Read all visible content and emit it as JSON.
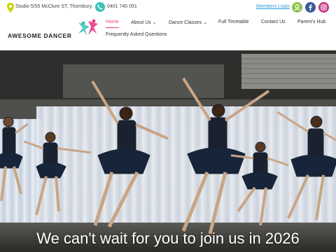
{
  "topbar": {
    "address": "Studio 5/55 McClure ST, Thornbury.",
    "phone": "0401 740 051",
    "members_login": "Members Login",
    "icons": [
      "location-pin-icon",
      "phone-icon",
      "user-icon",
      "facebook-icon",
      "instagram-icon"
    ]
  },
  "logo": {
    "text": "AWESOME DANCER"
  },
  "nav": {
    "home": "Home",
    "about": "About Us",
    "classes": "Dance Classes",
    "timetable": "Full Timetable",
    "contact": "Contact Us",
    "parents": "Parent's Hub",
    "faq": "Frequently Asked Questions"
  },
  "hero": {
    "title": "We can't wait for you to join us in 2026"
  },
  "colors": {
    "accent": "#e8388a",
    "link": "#2a9fd6",
    "phone": "#3cc1b8"
  }
}
